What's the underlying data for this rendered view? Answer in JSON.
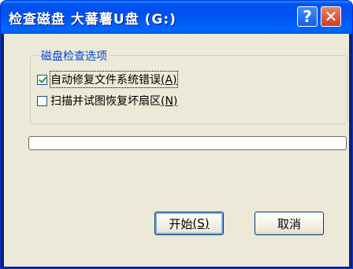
{
  "window": {
    "title": "检查磁盘 大蕃薯U盘 (G:)",
    "help_label": "?",
    "close_label": "✕"
  },
  "options": {
    "group_title": "磁盘检查选项",
    "items": [
      {
        "label": "自动修复文件系统错误",
        "mnemonic": "(A)",
        "checked": true
      },
      {
        "label": "扫描并试图恢复坏扇区",
        "mnemonic": "(N)",
        "checked": false
      }
    ]
  },
  "progress": {
    "value": 0
  },
  "buttons": {
    "start_label": "开始",
    "start_mnemonic": "(S)",
    "cancel_label": "取消"
  },
  "colors": {
    "title_bar": "#0053ee",
    "dialog_background": "#ece9d8",
    "group_title": "#0046d5",
    "close_button": "#c9401f"
  }
}
